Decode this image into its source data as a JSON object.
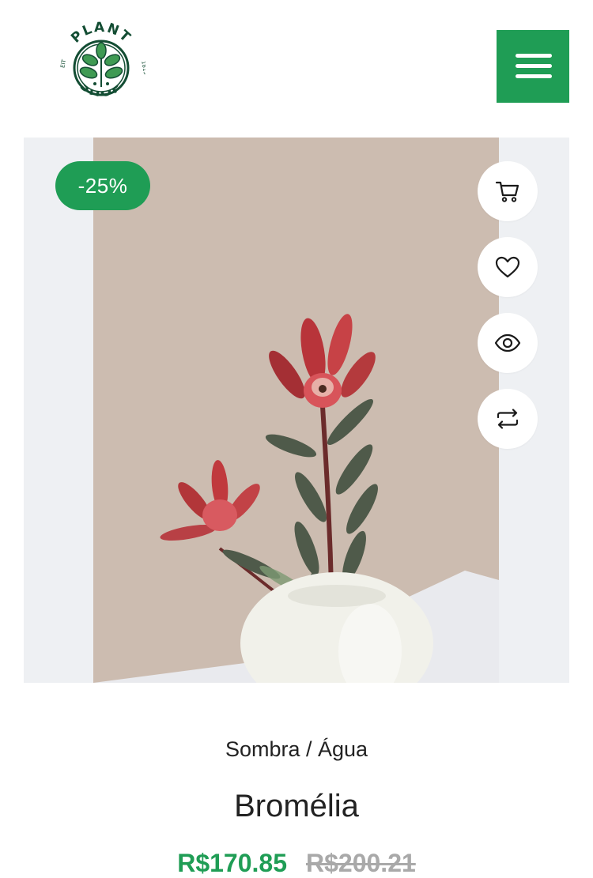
{
  "header": {
    "logo": {
      "top_text": "PLANT",
      "bottom_text": "SHOP",
      "left_text": "EIT",
      "right_text": "1815"
    },
    "menu_icon": "hamburger-menu-icon"
  },
  "product": {
    "discount_badge": "-25%",
    "image_subject": "red-flowering-plant-in-white-vase",
    "actions": [
      {
        "icon": "cart-icon"
      },
      {
        "icon": "heart-icon"
      },
      {
        "icon": "eye-icon"
      },
      {
        "icon": "compare-arrows-icon"
      }
    ],
    "category": "Sombra / Água",
    "name": "Bromélia",
    "price_current": "R$170.85",
    "price_original": "R$200.21"
  },
  "colors": {
    "accent": "#1f9d55",
    "logo_dark": "#134d33",
    "card_bg": "#eef0f3",
    "old_price": "#a9a9a9"
  }
}
